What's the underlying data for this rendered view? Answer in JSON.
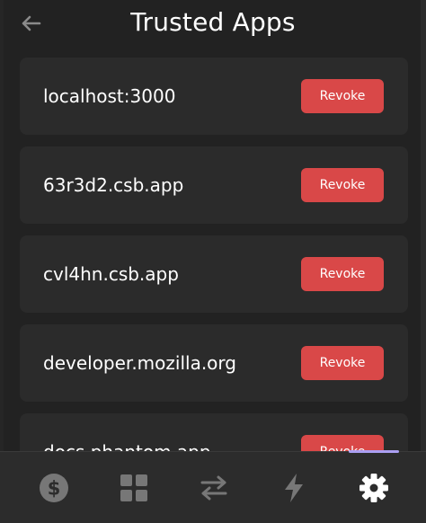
{
  "header": {
    "title": "Trusted Apps",
    "back_icon": "arrow-left-icon"
  },
  "apps": [
    {
      "domain": "localhost:3000",
      "action": "Revoke"
    },
    {
      "domain": "63r3d2.csb.app",
      "action": "Revoke"
    },
    {
      "domain": "cvl4hn.csb.app",
      "action": "Revoke"
    },
    {
      "domain": "developer.mozilla.org",
      "action": "Revoke"
    },
    {
      "domain": "docs.phantom.app",
      "action": "Revoke"
    }
  ],
  "tabs": [
    {
      "icon": "dollar-icon",
      "active": false
    },
    {
      "icon": "grid-icon",
      "active": false
    },
    {
      "icon": "swap-icon",
      "active": false
    },
    {
      "icon": "lightning-icon",
      "active": false
    },
    {
      "icon": "gear-icon",
      "active": true
    }
  ],
  "colors": {
    "background": "#222222",
    "card": "#2b2b2b",
    "revoke": "#d94848",
    "tab_inactive": "#777777",
    "tab_active": "#ffffff",
    "tab_indicator": "#ab9ff2"
  }
}
